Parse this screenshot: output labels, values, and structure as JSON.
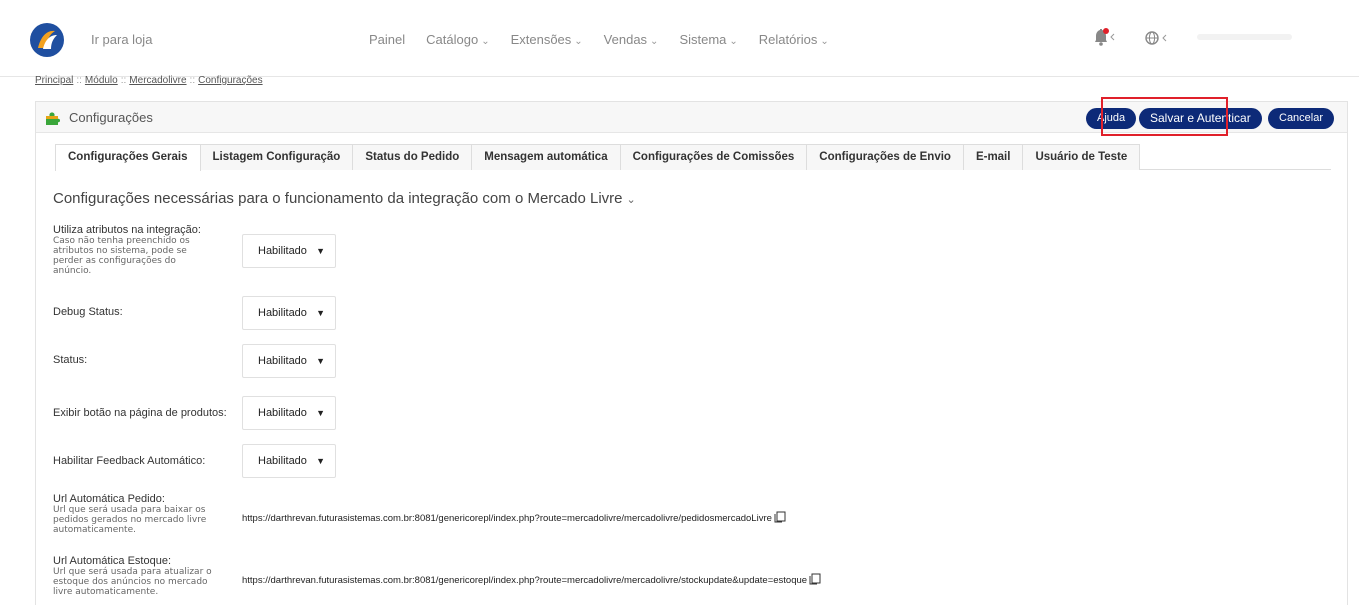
{
  "topbar": {
    "store_link": "Ir para loja",
    "nav": [
      {
        "label": "Painel",
        "dropdown": false
      },
      {
        "label": "Catálogo",
        "dropdown": true
      },
      {
        "label": "Extensões",
        "dropdown": true
      },
      {
        "label": "Vendas",
        "dropdown": true
      },
      {
        "label": "Sistema",
        "dropdown": true
      },
      {
        "label": "Relatórios",
        "dropdown": true
      }
    ],
    "chevron": "⌄",
    "notification_color": "#e0202a",
    "icons": [
      "logo-icon",
      "bell-icon",
      "globe-icon"
    ]
  },
  "breadcrumb": {
    "items": [
      "Principal",
      "Módulo",
      "Mercadolivre",
      "Configurações"
    ],
    "separator": "::"
  },
  "panel": {
    "title": "Configurações",
    "buttons": {
      "help": "Ajuda",
      "save": "Salvar e Autenticar",
      "cancel": "Cancelar"
    },
    "accent": "#0d2a78",
    "highlight_color": "#e0202a"
  },
  "tabs": [
    "Configurações Gerais",
    "Listagem Configuração",
    "Status do Pedido",
    "Mensagem automática",
    "Configurações de Comissões",
    "Configurações de Envio",
    "E-mail",
    "Usuário de Teste"
  ],
  "active_tab": "Configurações Gerais",
  "section": {
    "title": "Configurações necessárias para o funcionamento da integração com o Mercado Livre",
    "chevron": "⌄"
  },
  "fields": [
    {
      "label": "Utiliza atributos na integração:",
      "hint": [
        "Caso não tenha preenchido os",
        "atributos no sistema, pode se",
        "perder as configurações do",
        "anúncio."
      ],
      "value": "Habilitado"
    },
    {
      "label": "Debug Status:",
      "hint": [],
      "value": "Habilitado"
    },
    {
      "label": "Status:",
      "hint": [],
      "value": "Habilitado"
    },
    {
      "label": "Exibir botão na página de produtos:",
      "hint": [],
      "value": "Habilitado"
    },
    {
      "label": "Habilitar Feedback Automático:",
      "hint": [],
      "value": "Habilitado"
    }
  ],
  "select_arrow": "▼",
  "urls": [
    {
      "label": "Url Automática Pedido:",
      "hint": [
        "Url que será usada para baixar os",
        "pedidos gerados no mercado livre",
        "automaticamente."
      ],
      "value": "https://darthrevan.futurasistemas.com.br:8081/genericorepl/index.php?route=mercadolivre/mercadolivre/pedidosmercadoLivre"
    },
    {
      "label": "Url Automática Estoque:",
      "hint": [
        "Url que será usada para atualizar o",
        "estoque dos anúncios no mercado",
        "livre automaticamente."
      ],
      "value": "https://darthrevan.futurasistemas.com.br:8081/genericorepl/index.php?route=mercadolivre/mercadolivre/stockupdate&update=estoque"
    }
  ]
}
